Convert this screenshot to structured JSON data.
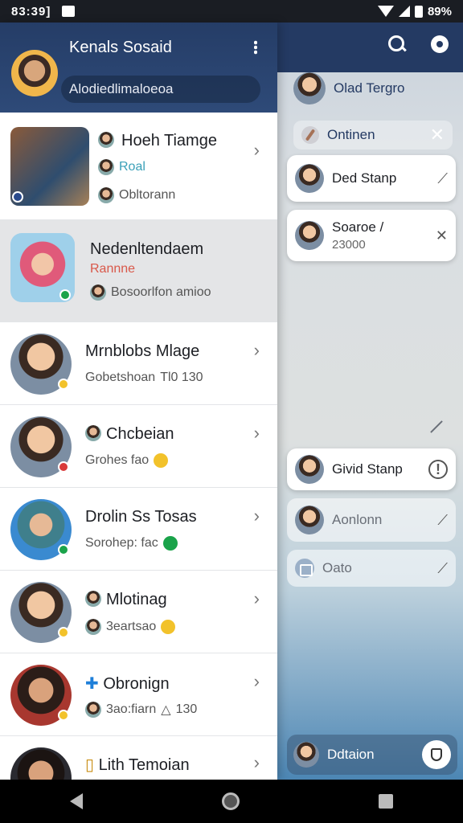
{
  "status": {
    "time": "83:39]",
    "battery": "89%"
  },
  "drawer": {
    "title": "Kenals Sosaid",
    "search_placeholder": "Alodiedlimaloeoa",
    "rows": [
      {
        "name": "Hoeh Tiamge",
        "line2": "Roal",
        "line3": "Obltorann"
      },
      {
        "name": "Nedenltendaem",
        "tag": "Rannne",
        "sub": "Bosoorlfon amioo"
      },
      {
        "name": "Mrnblobs Mlage",
        "sub": "Gobetshoan",
        "sub_extra": "Tl0 130"
      },
      {
        "name": "Chcbeian",
        "sub": "Grohes fao"
      },
      {
        "name": "Drolin Ss Tosas",
        "sub": "Sorohep: fac"
      },
      {
        "name": "Mlotinag",
        "sub": "3eartsao"
      },
      {
        "name": "Obronign",
        "sub": "3ao:fiarn",
        "sub_extra": "130"
      },
      {
        "name": "Lith Temoian"
      }
    ]
  },
  "right": {
    "user_name": "Olad Tergro",
    "filter_label": "Ontinen",
    "cards": [
      {
        "label": "Ded Stanp"
      },
      {
        "label": "Soaroe /",
        "sub": "23000"
      },
      {
        "label": "Givid Stanp"
      },
      {
        "label": "Aonlonn"
      },
      {
        "label": "Oato"
      }
    ],
    "bottom_label": "Ddtaion"
  },
  "colors": {
    "header": "#253d67",
    "accent": "#1aa34a"
  }
}
